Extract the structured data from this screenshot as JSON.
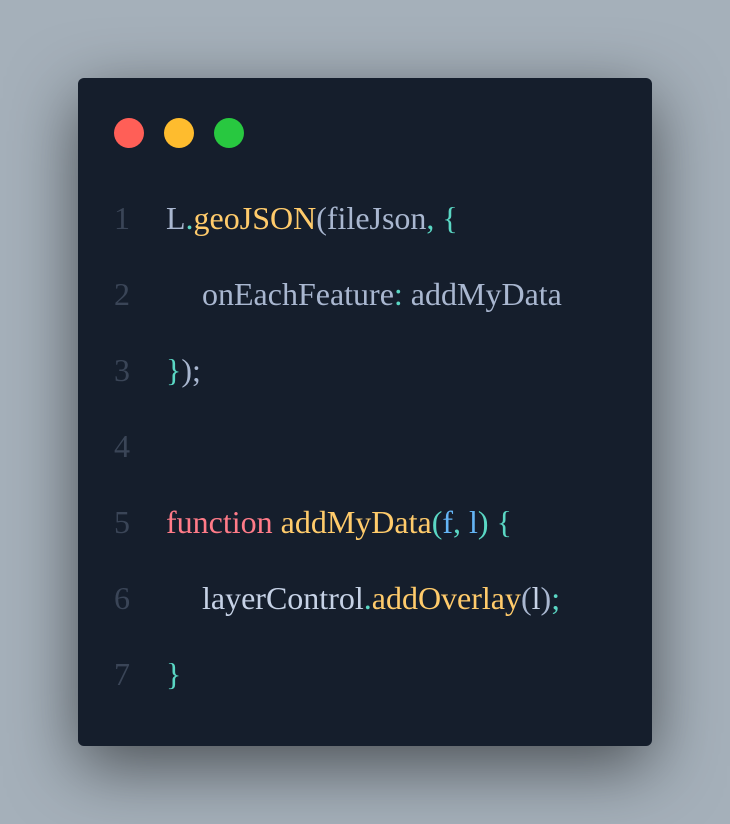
{
  "window": {
    "background_color": "#151e2c",
    "page_background_color": "#a5b0ba",
    "traffic_lights": [
      {
        "name": "close",
        "color": "#ff5f57"
      },
      {
        "name": "minimize",
        "color": "#febc2e"
      },
      {
        "name": "maximize",
        "color": "#28c840"
      }
    ]
  },
  "colors": {
    "default": "#a9b7d0",
    "punct": "#5ad7c4",
    "function": "#ffcb6b",
    "keyword": "#ff7b88",
    "param": "#64b5f6",
    "identifier": "#c6d2e6",
    "line_number": "#3a4557"
  },
  "code": {
    "lines": [
      {
        "number": "1",
        "indent": false,
        "tokens": [
          {
            "text": "L",
            "kind": "default"
          },
          {
            "text": ".",
            "kind": "punct"
          },
          {
            "text": "geoJSON",
            "kind": "function"
          },
          {
            "text": "(",
            "kind": "default"
          },
          {
            "text": "fileJson",
            "kind": "default"
          },
          {
            "text": ", ",
            "kind": "punct"
          },
          {
            "text": "{",
            "kind": "punct"
          }
        ]
      },
      {
        "number": "2",
        "indent": true,
        "tokens": [
          {
            "text": "onEachFeature",
            "kind": "default"
          },
          {
            "text": ": ",
            "kind": "punct"
          },
          {
            "text": "addMyData",
            "kind": "default"
          }
        ]
      },
      {
        "number": "3",
        "indent": false,
        "tokens": [
          {
            "text": "}",
            "kind": "punct"
          },
          {
            "text": ");",
            "kind": "default"
          }
        ]
      },
      {
        "number": "4",
        "indent": false,
        "tokens": []
      },
      {
        "number": "5",
        "indent": false,
        "tokens": [
          {
            "text": "function",
            "kind": "keyword"
          },
          {
            "text": " ",
            "kind": "default"
          },
          {
            "text": "addMyData",
            "kind": "function"
          },
          {
            "text": "(",
            "kind": "punct"
          },
          {
            "text": "f",
            "kind": "param"
          },
          {
            "text": ", ",
            "kind": "punct"
          },
          {
            "text": "l",
            "kind": "param"
          },
          {
            "text": ")",
            "kind": "punct"
          },
          {
            "text": " ",
            "kind": "default"
          },
          {
            "text": "{",
            "kind": "punct"
          }
        ]
      },
      {
        "number": "6",
        "indent": true,
        "tokens": [
          {
            "text": "layerControl",
            "kind": "identifier"
          },
          {
            "text": ".",
            "kind": "punct"
          },
          {
            "text": "addOverlay",
            "kind": "function"
          },
          {
            "text": "(",
            "kind": "default"
          },
          {
            "text": "l",
            "kind": "identifier"
          },
          {
            "text": ")",
            "kind": "default"
          },
          {
            "text": ";",
            "kind": "punct"
          }
        ]
      },
      {
        "number": "7",
        "indent": false,
        "tokens": [
          {
            "text": "}",
            "kind": "punct"
          }
        ]
      }
    ]
  }
}
